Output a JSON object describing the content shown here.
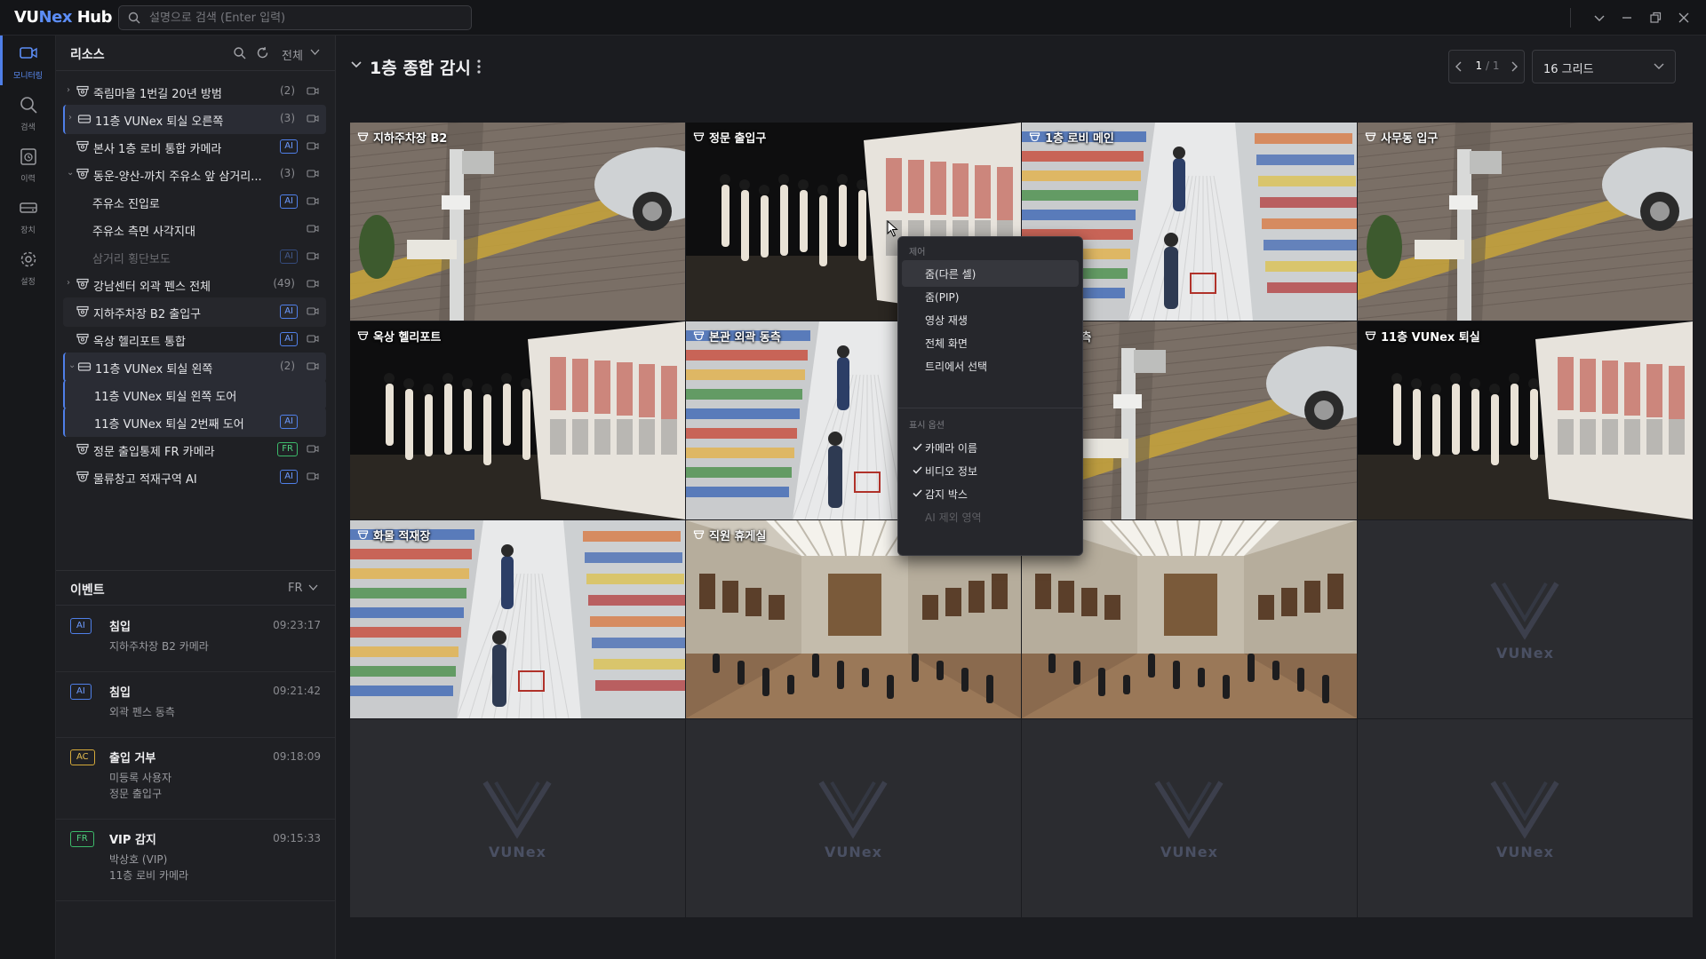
{
  "app": {
    "logo_prefix": "VU",
    "logo_accent": "Nex",
    "logo_suffix": " Hub",
    "search_placeholder": "설명으로 검색 (Enter 입력)",
    "brand_color": "#4f7fe8"
  },
  "rail": {
    "items": [
      {
        "label": "모니터링",
        "icon": "monitor-camera-icon",
        "active": true
      },
      {
        "label": "검색",
        "icon": "search-icon",
        "active": false
      },
      {
        "label": "이력",
        "icon": "history-icon",
        "active": false
      },
      {
        "label": "장치",
        "icon": "device-icon",
        "active": false
      },
      {
        "label": "설정",
        "icon": "gear-icon",
        "active": false
      }
    ]
  },
  "resources": {
    "title": "리소스",
    "filter": "전체",
    "nodes": [
      {
        "label": "죽림마을 1번길 20년 방범",
        "count": "(2)",
        "expand": "›",
        "icon": "camera-group"
      },
      {
        "label": "11층 VUNex 퇴실 오른쪽",
        "count": "(3)",
        "expand": "›",
        "icon": "nvr"
      },
      {
        "label": "본사 1층 로비 통합 카메라",
        "badge": "AI",
        "icon": "camera-group"
      },
      {
        "label": "동운-양산-까치 주유소 앞 삼거리...",
        "count": "(3)",
        "expand": "⌄",
        "icon": "camera-group"
      },
      {
        "label": "주유소 진입로",
        "badge": "AI",
        "icon": "none"
      },
      {
        "label": "주유소 측면 사각지대",
        "icon": "none"
      },
      {
        "label": "삼거리 횡단보도",
        "badge": "AI",
        "icon": "none"
      },
      {
        "label": "강남센터 외곽 펜스 전체",
        "count": "(49)",
        "expand": "›",
        "icon": "camera-group"
      },
      {
        "label": "지하주차장 B2 출입구",
        "badge": "AI",
        "icon": "camera-group"
      },
      {
        "label": "옥상 헬리포트 통합",
        "badge": "AI",
        "icon": "camera-group"
      },
      {
        "label": "11층 VUNex 퇴실 왼쪽",
        "count": "(2)",
        "expand": "⌄",
        "icon": "nvr"
      },
      {
        "label": "11층 VUNex 퇴실 왼쪽 도어",
        "icon": "none"
      },
      {
        "label": "11층 VUNex 퇴실 2번째 도어",
        "badge": "AI",
        "icon": "none"
      },
      {
        "label": "정문 출입통제 FR 카메라",
        "badge": "FR",
        "icon": "camera-group"
      },
      {
        "label": "물류창고 적재구역 AI",
        "badge": "AI",
        "icon": "camera-group"
      }
    ]
  },
  "events": {
    "title": "이벤트",
    "filter": "FR",
    "items": [
      {
        "badge": "AI",
        "title": "침입",
        "time": "09:23:17",
        "line1": "지하주차장 B2 카메라",
        "line2": ""
      },
      {
        "badge": "AI",
        "title": "침입",
        "time": "09:21:42",
        "line1": "외곽 펜스 동측",
        "line2": ""
      },
      {
        "badge": "AC",
        "title": "출입 거부",
        "time": "09:18:09",
        "line1": "미등록 사용자",
        "line2": "정문 출입구"
      },
      {
        "badge": "FR",
        "title": "VIP 감지",
        "time": "09:15:33",
        "line1": "박상호 (VIP)",
        "line2": "11층 로비 카메라"
      }
    ]
  },
  "view": {
    "title": "1층 종합 감시",
    "page_current": "1",
    "page_total": "/ 1",
    "grid_option": "16 그리드"
  },
  "cells": [
    {
      "label": "지하주차장 B2",
      "scene": "parking"
    },
    {
      "label": "정문 출입구",
      "scene": "gallery"
    },
    {
      "label": "1층 로비 메인",
      "scene": "store"
    },
    {
      "label": "사무동 입구",
      "scene": "parking"
    },
    {
      "label": "옥상 헬리포트",
      "scene": "gallery"
    },
    {
      "label": "본관 외곽 동측",
      "scene": "store"
    },
    {
      "label": "외곽 서측",
      "scene": "parking"
    },
    {
      "label": "11층 VUNex 퇴실",
      "scene": "gallery"
    },
    {
      "label": "화물 적재장",
      "scene": "store"
    },
    {
      "label": "직원 휴게실",
      "scene": "museum"
    },
    {
      "label": "복도",
      "scene": "museum"
    },
    {
      "label": "",
      "scene": "empty"
    },
    {
      "label": "",
      "scene": "empty"
    },
    {
      "label": "",
      "scene": "empty"
    },
    {
      "label": "",
      "scene": "empty"
    },
    {
      "label": "",
      "scene": "empty"
    }
  ],
  "watermark": "VUNex",
  "context_menu": {
    "section1": "제어",
    "items1": [
      "줌(다른 셀)",
      "줌(PIP)",
      "영상 재생",
      "전체 화면",
      "트리에서 선택"
    ],
    "section2": "표시 옵션",
    "items2": [
      {
        "label": "카메라 이름",
        "checked": true,
        "disabled": false
      },
      {
        "label": "비디오 정보",
        "checked": true,
        "disabled": false
      },
      {
        "label": "감지 박스",
        "checked": true,
        "disabled": false
      },
      {
        "label": "AI 제외 영역",
        "checked": false,
        "disabled": true
      }
    ]
  }
}
